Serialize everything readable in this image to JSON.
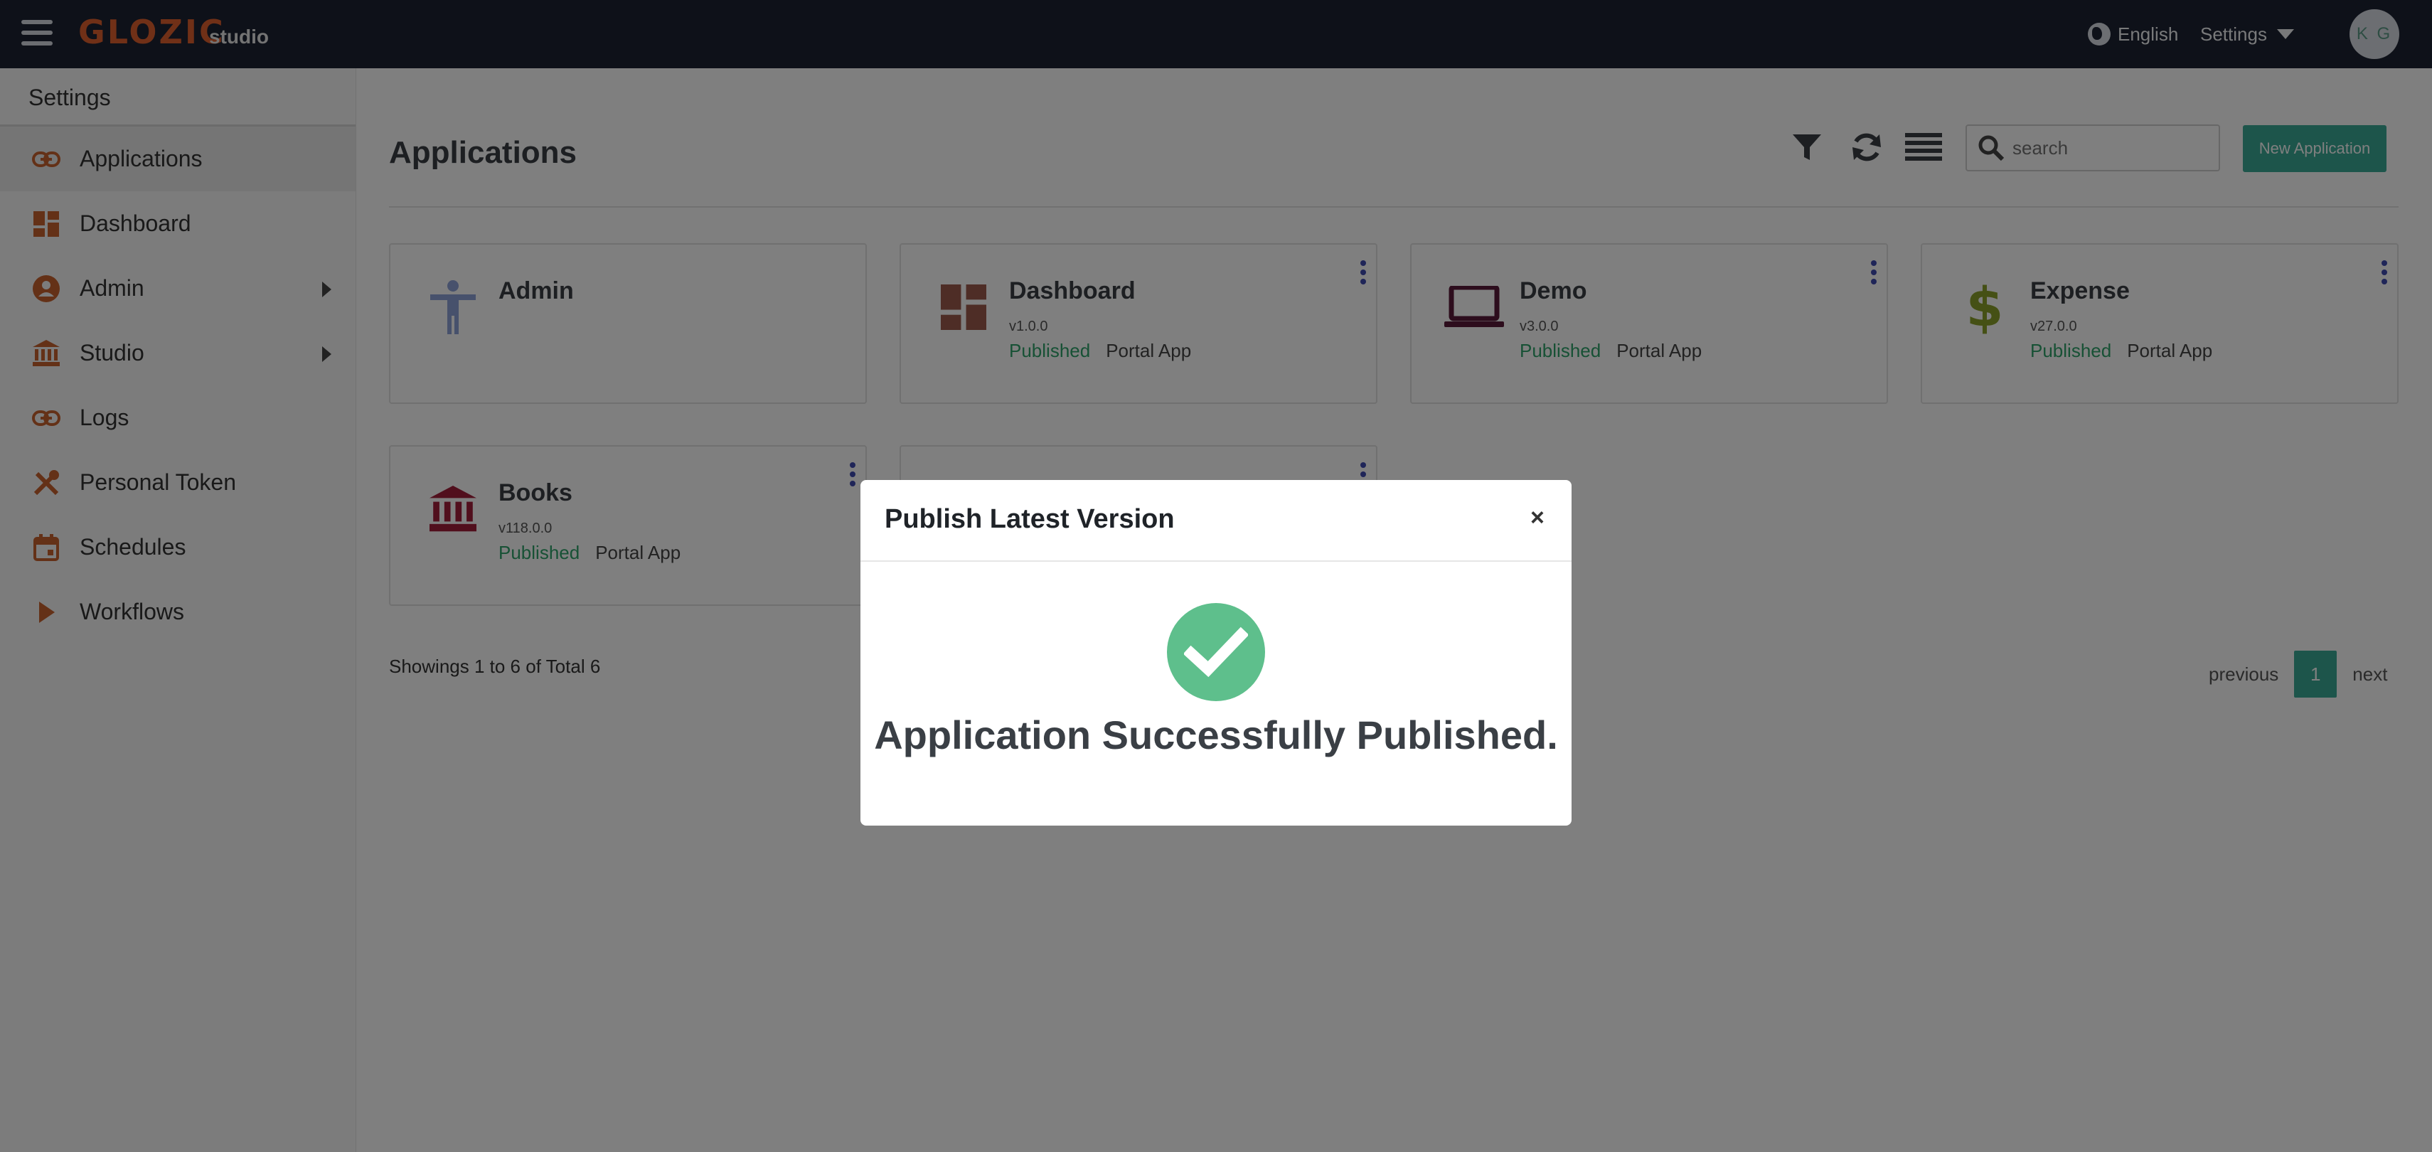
{
  "header": {
    "logo": "GLOZIC",
    "logo_sub": "studio",
    "language": "English",
    "settings": "Settings",
    "avatar_initials": "K G"
  },
  "sidebar": {
    "title": "Settings",
    "items": [
      {
        "label": "Applications",
        "icon": "link-icon",
        "active": true
      },
      {
        "label": "Dashboard",
        "icon": "dashboard-icon"
      },
      {
        "label": "Admin",
        "icon": "user-circle-icon",
        "submenu": true
      },
      {
        "label": "Studio",
        "icon": "bank-icon",
        "submenu": true
      },
      {
        "label": "Logs",
        "icon": "link-icon"
      },
      {
        "label": "Personal Token",
        "icon": "tools-icon"
      },
      {
        "label": "Schedules",
        "icon": "calendar-icon"
      },
      {
        "label": "Workflows",
        "icon": "play-icon"
      }
    ]
  },
  "main": {
    "title": "Applications",
    "search_placeholder": "search",
    "new_button": "New Application",
    "cards": [
      {
        "name": "Admin",
        "version": "",
        "status": "",
        "type": "",
        "icon": "accessibility-icon"
      },
      {
        "name": "Dashboard",
        "version": "v1.0.0",
        "status": "Published",
        "type": "Portal App",
        "icon": "dashboard-icon"
      },
      {
        "name": "Demo",
        "version": "v3.0.0",
        "status": "Published",
        "type": "Portal App",
        "icon": "laptop-icon"
      },
      {
        "name": "Expense",
        "version": "v27.0.0",
        "status": "Published",
        "type": "Portal App",
        "icon": "dollar-icon"
      },
      {
        "name": "Books",
        "version": "v118.0.0",
        "status": "Published",
        "type": "Portal App",
        "icon": "bank-icon"
      }
    ],
    "showing": "Showings 1 to 6 of Total 6",
    "pagination": {
      "previous": "previous",
      "current": "1",
      "next": "next"
    }
  },
  "modal": {
    "title": "Publish Latest Version",
    "close": "×",
    "message": "Application Successfully Published."
  },
  "colors": {
    "topbar": "#1c2332",
    "accent": "#3aaa96",
    "published": "#2ea36a",
    "success": "#5ebf8c",
    "icon_orange": "#c9632f"
  }
}
